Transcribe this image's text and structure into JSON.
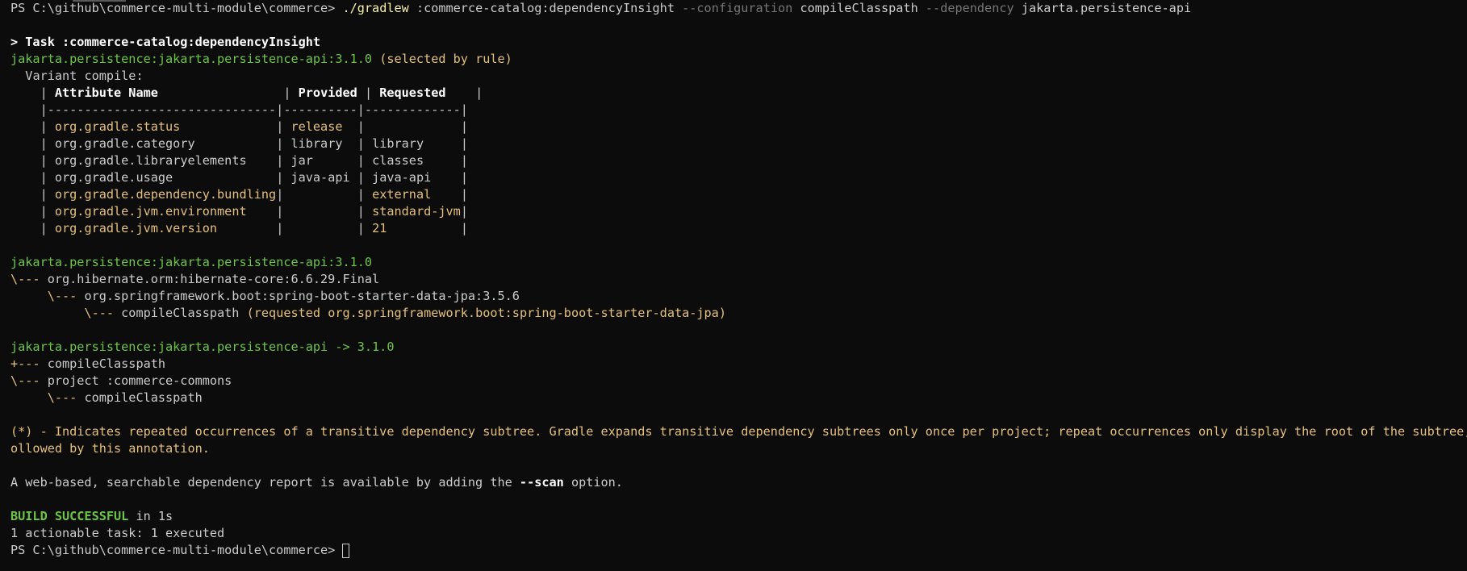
{
  "prompt_path": "PS C:\\github\\commerce-multi-module\\commerce>",
  "command": {
    "exe": "./gradlew",
    "task": ":commerce-catalog:dependencyInsight",
    "flag1": "--configuration",
    "arg1": "compileClasspath",
    "flag2": "--dependency",
    "arg2": "jakarta.persistence-api"
  },
  "task_header": "> Task :commerce-catalog:dependencyInsight",
  "selected": {
    "coord": "jakarta.persistence:jakarta.persistence-api:3.1.0",
    "note": "(selected by rule)"
  },
  "variant": "Variant compile:",
  "table": {
    "headers": [
      "Attribute Name",
      "Provided",
      "Requested"
    ],
    "separator": "|-------------------------------|----------|-------------|",
    "rows": [
      {
        "name": "org.gradle.status",
        "provided": "release",
        "requested": "",
        "highlight": true
      },
      {
        "name": "org.gradle.category",
        "provided": "library",
        "requested": "library",
        "highlight": false
      },
      {
        "name": "org.gradle.libraryelements",
        "provided": "jar",
        "requested": "classes",
        "highlight": false
      },
      {
        "name": "org.gradle.usage",
        "provided": "java-api",
        "requested": "java-api",
        "highlight": false
      },
      {
        "name": "org.gradle.dependency.bundling",
        "provided": "",
        "requested": "external",
        "highlight": true
      },
      {
        "name": "org.gradle.jvm.environment",
        "provided": "",
        "requested": "standard-jvm",
        "highlight": true
      },
      {
        "name": "org.gradle.jvm.version",
        "provided": "",
        "requested": "21",
        "highlight": true
      }
    ]
  },
  "tree1": {
    "root": "jakarta.persistence:jakarta.persistence-api:3.1.0",
    "l1_prefix": "\\--- ",
    "l1": "org.hibernate.orm:hibernate-core:6.6.29.Final",
    "l2_prefix": "     \\--- ",
    "l2": "org.springframework.boot:spring-boot-starter-data-jpa:3.5.6",
    "l3_prefix": "          \\--- ",
    "l3": "compileClasspath",
    "l3_note": "(requested org.springframework.boot:spring-boot-starter-data-jpa)"
  },
  "tree2": {
    "root": "jakarta.persistence:jakarta.persistence-api -> 3.1.0",
    "a_prefix": "+--- ",
    "a": "compileClasspath",
    "b_prefix": "\\--- ",
    "b": "project :commerce-commons",
    "c_prefix": "     \\--- ",
    "c": "compileClasspath"
  },
  "note_line1": "(*) - Indicates repeated occurrences of a transitive dependency subtree. Gradle expands transitive dependency subtrees only once per project; repeat occurrences only display the root of the subtree, f",
  "note_line2": "ollowed by this annotation.",
  "scan_pre": "A web-based, searchable dependency report is available by adding the ",
  "scan_flag": "--scan",
  "scan_post": " option.",
  "build_status": "BUILD SUCCESSFUL",
  "build_time": " in 1s",
  "actionable": "1 actionable task: 1 executed"
}
